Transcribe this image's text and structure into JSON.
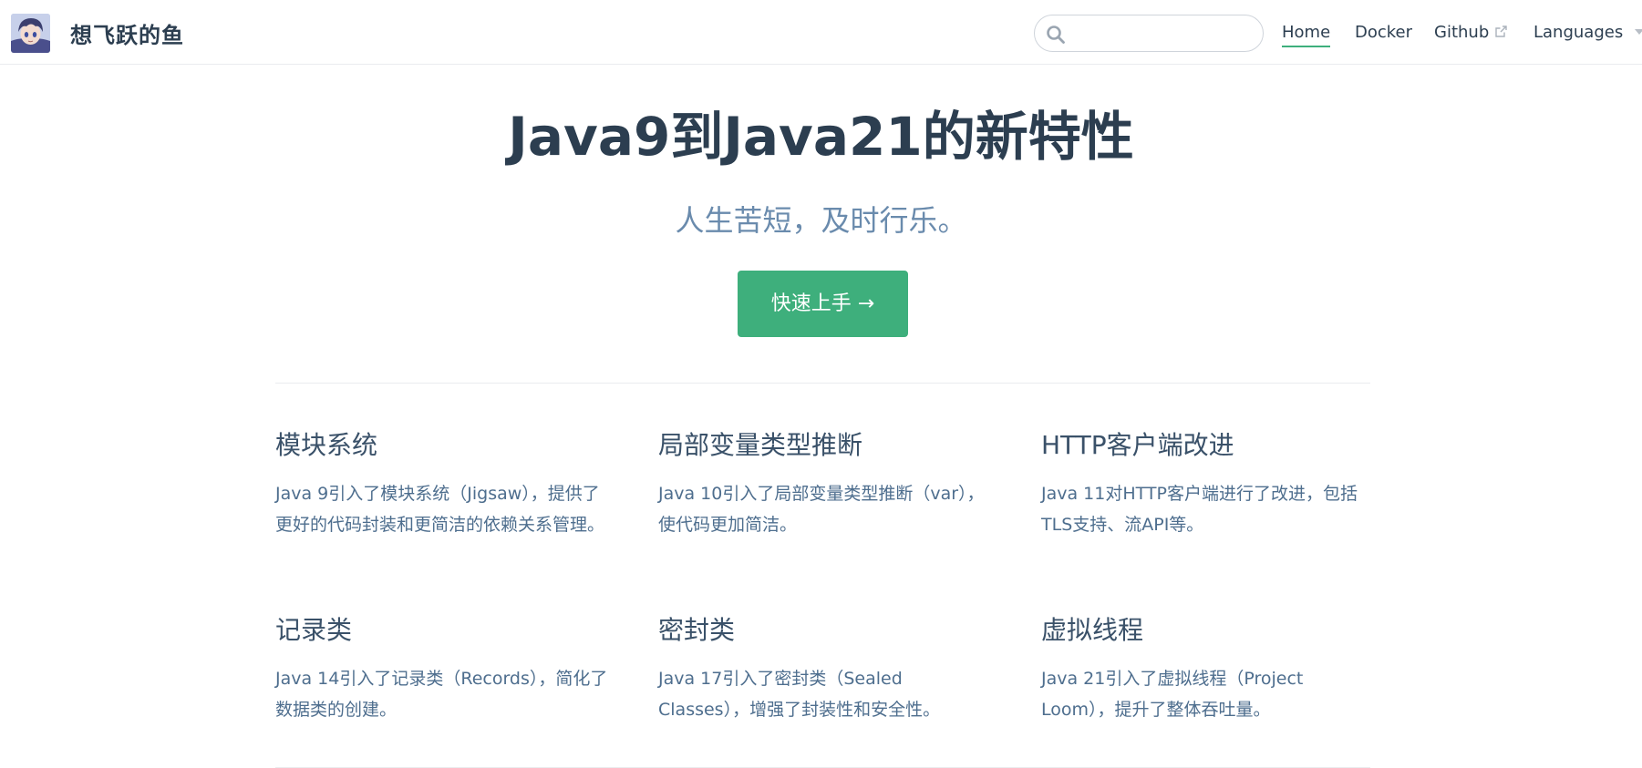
{
  "header": {
    "site_name": "想飞跃的鱼",
    "search": {
      "placeholder": "",
      "value": ""
    },
    "nav": [
      {
        "label": "Home",
        "active": true
      },
      {
        "label": "Docker",
        "active": false
      },
      {
        "label": "Github",
        "external": true,
        "icon": "external-link-icon"
      },
      {
        "label": "Languages",
        "dropdown": true,
        "icon": "chevron-down-icon"
      }
    ]
  },
  "hero": {
    "title": "Java9到Java21的新特性",
    "tagline": "人生苦短，及时行乐。",
    "action_label": "快速上手 →"
  },
  "features": [
    {
      "title": "模块系统",
      "details": "Java 9引入了模块系统（Jigsaw），提供了更好的代码封装和更简洁的依赖关系管理。"
    },
    {
      "title": "局部变量类型推断",
      "details": "Java 10引入了局部变量类型推断（var），使代码更加简洁。"
    },
    {
      "title": "HTTP客户端改进",
      "details": "Java 11对HTTP客户端进行了改进，包括TLS支持、流API等。"
    },
    {
      "title": "记录类",
      "details": "Java 14引入了记录类（Records），简化了数据类的创建。"
    },
    {
      "title": "密封类",
      "details": "Java 17引入了密封类（Sealed Classes），增强了封装性和安全性。"
    },
    {
      "title": "虚拟线程",
      "details": "Java 21引入了虚拟线程（Project Loom），提升了整体吞吐量。"
    }
  ],
  "colors": {
    "accent": "#3eaf7c",
    "text": "#2c3e50",
    "muted": "#6a8bad",
    "border": "#eaecef"
  }
}
